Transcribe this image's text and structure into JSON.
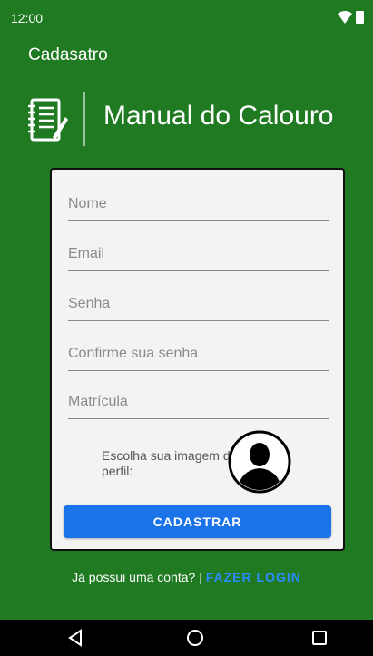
{
  "status_bar": {
    "time": "12:00"
  },
  "app_bar": {
    "title": "Cadasatro"
  },
  "header": {
    "title": "Manual do Calouro"
  },
  "form": {
    "name_placeholder": "Nome",
    "email_placeholder": "Email",
    "password_placeholder": "Senha",
    "confirm_password_placeholder": "Confirme sua senha",
    "registration_placeholder": "Matrícula",
    "profile_label": "Escolha sua imagem de perfil:",
    "submit_label": "CADASTRAR"
  },
  "footer": {
    "question": "Já possui uma conta? | ",
    "login_link": "FAZER LOGIN"
  },
  "colors": {
    "background": "#1f7a22",
    "card": "#f3f3f3",
    "primary_button": "#1a73e8",
    "link": "#2b8cff"
  },
  "icons": [
    "wifi-icon",
    "battery-icon",
    "notebook-icon",
    "avatar-icon",
    "back-icon",
    "home-icon",
    "recent-apps-icon"
  ]
}
